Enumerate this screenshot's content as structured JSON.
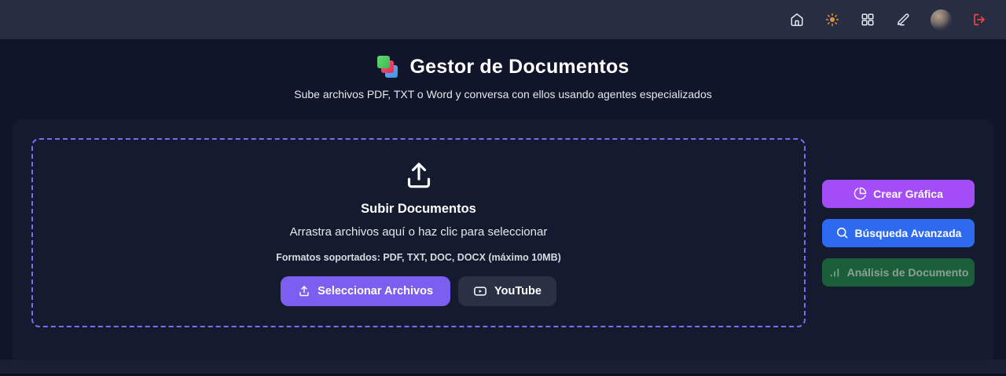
{
  "topbar": {
    "icons": [
      "home",
      "theme-sun",
      "apps-grid",
      "edit-pencil",
      "avatar",
      "logout"
    ]
  },
  "header": {
    "title": "Gestor de Documentos",
    "subtitle": "Sube archivos PDF, TXT o Word y conversa con ellos usando agentes especializados"
  },
  "dropzone": {
    "title": "Subir Documentos",
    "hint": "Arrastra archivos aquí o haz clic para seleccionar",
    "formats": "Formatos soportados: PDF, TXT, DOC, DOCX (máximo 10MB)",
    "select_button": "Seleccionar Archivos",
    "youtube_button": "YouTube"
  },
  "actions": {
    "create_chart": "Crear Gráfica",
    "advanced_search": "Búsqueda Avanzada",
    "document_analysis": "Análisis de Documento"
  },
  "colors": {
    "topbar_bg": "#272e42",
    "page_bg": "#10152a",
    "card_bg": "#151b2e",
    "dropzone_border": "#7b6cf2",
    "select_button_purple": "#7c5ef0",
    "youtube_button_dark": "#2a3144",
    "create_chart_purple": "#a44df6",
    "advanced_search_blue": "#2e6af0",
    "document_analysis_green": "#1b5e3a",
    "logout_red": "#ef4444",
    "sun_orange": "#e0913d"
  }
}
